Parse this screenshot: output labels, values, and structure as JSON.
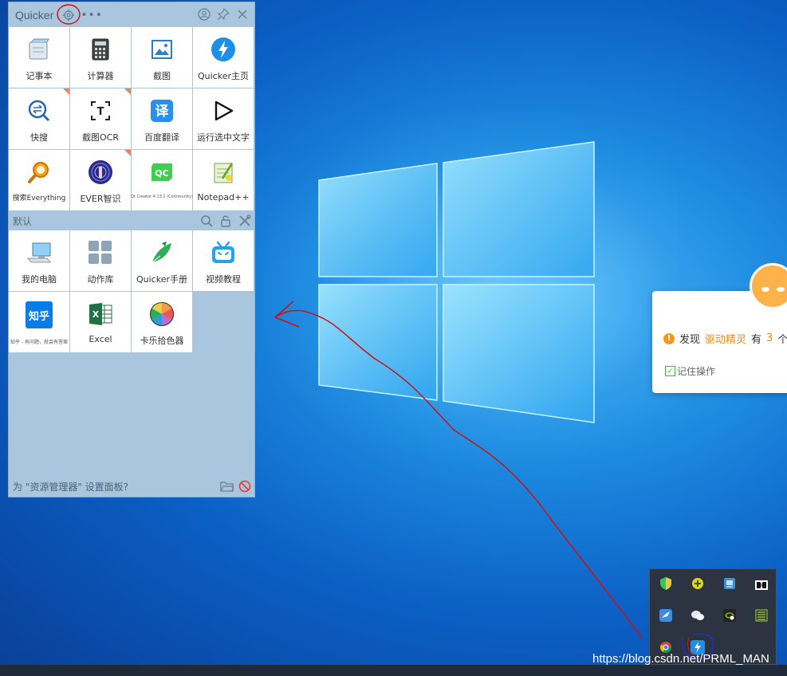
{
  "panel": {
    "title": "Quicker",
    "more_icon": "more-dots-icon",
    "settings_icon": "gear-icon",
    "header_actions": [
      "user-icon",
      "pin-icon",
      "close-icon"
    ],
    "top_actions": [
      {
        "label": "记事本",
        "icon": "notepad-icon",
        "badge": false
      },
      {
        "label": "计算器",
        "icon": "calculator-icon",
        "badge": false
      },
      {
        "label": "截图",
        "icon": "screenshot-icon",
        "badge": false
      },
      {
        "label": "Quicker主页",
        "icon": "quicker-bolt-icon",
        "badge": false
      },
      {
        "label": "快搜",
        "icon": "quick-search-icon",
        "badge": true
      },
      {
        "label": "截图OCR",
        "icon": "ocr-icon",
        "badge": true
      },
      {
        "label": "百度翻译",
        "icon": "translate-icon",
        "badge": false
      },
      {
        "label": "运行选中文字",
        "icon": "play-icon",
        "badge": false
      },
      {
        "label": "搜索Everything",
        "icon": "everything-search-icon",
        "badge": false
      },
      {
        "label": "EVER智识",
        "icon": "ever-icon",
        "badge": true
      },
      {
        "label": "Qt Creator 4.13.1 (Community)",
        "icon": "qt-icon",
        "badge": false
      },
      {
        "label": "Notepad++",
        "icon": "notepadpp-icon",
        "badge": false
      }
    ],
    "section_label": "默认",
    "section_actions": [
      "search-icon",
      "lock-icon",
      "tools-icon"
    ],
    "default_actions": [
      {
        "label": "我的电脑",
        "icon": "computer-icon"
      },
      {
        "label": "动作库",
        "icon": "action-library-icon"
      },
      {
        "label": "Quicker手册",
        "icon": "manual-bird-icon"
      },
      {
        "label": "视频教程",
        "icon": "bilibili-tv-icon"
      },
      {
        "label": "知乎 - 有问题，就会有答案",
        "icon": "zhihu-icon",
        "icon_text": "知乎"
      },
      {
        "label": "Excel",
        "icon": "excel-icon"
      },
      {
        "label": "卡乐拾色器",
        "icon": "color-picker-icon"
      }
    ],
    "footer_text": "为 \"资源管理器\" 设置面板?",
    "footer_actions": [
      "folder-icon",
      "ban-icon"
    ]
  },
  "popup": {
    "prefix": "发现",
    "app": "驱动精灵",
    "middle": "有",
    "count": "3",
    "suffix": "个",
    "remember": "记住操作"
  },
  "tray": {
    "icons": [
      "shield-icon",
      "add-circle-icon",
      "network-icon",
      "dolby-icon",
      "feishu-icon",
      "wechat-icon",
      "nvidia-icon",
      "monitor-icon",
      "chrome-icon",
      "quicker-tray-icon"
    ]
  },
  "watermark": "https://blog.csdn.net/PRML_MAN",
  "colors": {
    "panel_bg": "#a9c6de",
    "accent_orange": "#f08a24",
    "annotation_red": "#d01010"
  }
}
